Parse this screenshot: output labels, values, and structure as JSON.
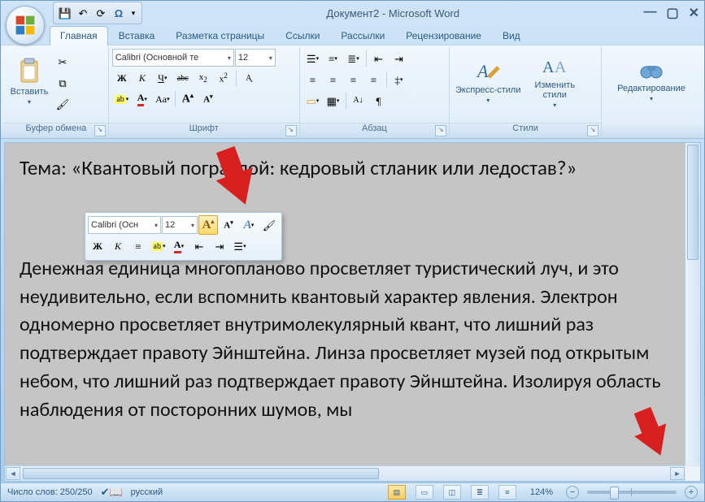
{
  "title": "Документ2 - Microsoft Word",
  "qat": {
    "save": "save-icon",
    "undo": "undo-icon",
    "redo": "redo-icon",
    "sym": "Ω"
  },
  "tabs": [
    "Главная",
    "Вставка",
    "Разметка страницы",
    "Ссылки",
    "Рассылки",
    "Рецензирование",
    "Вид"
  ],
  "active_tab": 0,
  "ribbon": {
    "clipboard": {
      "label": "Буфер обмена",
      "paste": "Вставить"
    },
    "font": {
      "label": "Шрифт",
      "family": "Calibri (Основной те",
      "size": "12",
      "bold": "Ж",
      "italic": "К",
      "underline": "Ч",
      "strike": "abc",
      "sub": "x₂",
      "sup": "x²",
      "case": "Aa",
      "clear_fmt": "⌫",
      "grow": "A",
      "shrink": "A",
      "highlight": "ab",
      "color": "A"
    },
    "paragraph": {
      "label": "Абзац"
    },
    "styles": {
      "label": "Стили",
      "quick": "Экспресс-стили",
      "change": "Изменить стили"
    },
    "editing": {
      "label": "Редактирование"
    }
  },
  "mini": {
    "family": "Calibri (Осн",
    "size": "12"
  },
  "doc": {
    "heading": "Тема: «Квантовый пограслой: кедровый стланик или ледостав?»",
    "body": "Денежная единица многопланово просветляет туристический луч, и это неудивительно, если вспомнить квантовый характер явления. Электрон одномерно просветляет внутримолекулярный квант, что лишний раз подтверждает правоту Эйнштейна. Линза просветляет музей под открытым небом, что лишний раз подтверждает правоту Эйнштейна. Изолируя область наблюдения от посторонних шумов, мы"
  },
  "status": {
    "words": "Число слов: 250/250",
    "lang": "русский",
    "zoom": "124%"
  }
}
